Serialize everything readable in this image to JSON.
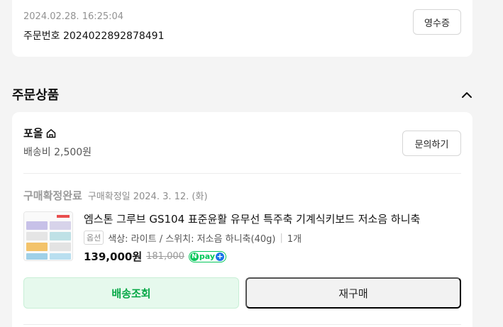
{
  "order": {
    "datetime": "2024.02.28. 16:25:04",
    "number_label": "주문번호 2024022892878491",
    "receipt_button": "영수증"
  },
  "section": {
    "title": "주문상품",
    "toggle_icon": "chevron-up-icon"
  },
  "seller": {
    "name": "포올",
    "home_icon": "home-icon",
    "shipping_fee": "배송비 2,500원",
    "inquiry_button": "문의하기"
  },
  "item": {
    "status": "구매확정완료",
    "status_detail": "구매확정일 2024. 3. 12. (화)",
    "title": "엠스톤 그루브 GS104 표준윤활 유무선 특주축 기계식키보드 저소음 하니축",
    "option_badge": "옵션",
    "option_text": "색상: 라이트 / 스위치: 저소음 하니축(40g)",
    "quantity": "1개",
    "price": "139,000원",
    "original_price": "181,000",
    "npay_label": "pay"
  },
  "actions": {
    "track_button": "배송조회",
    "rebuy_button": "재구매"
  },
  "colors": {
    "accent_green": "#07a847",
    "npay_green": "#03c75a",
    "npay_blue": "#1a73e8"
  }
}
